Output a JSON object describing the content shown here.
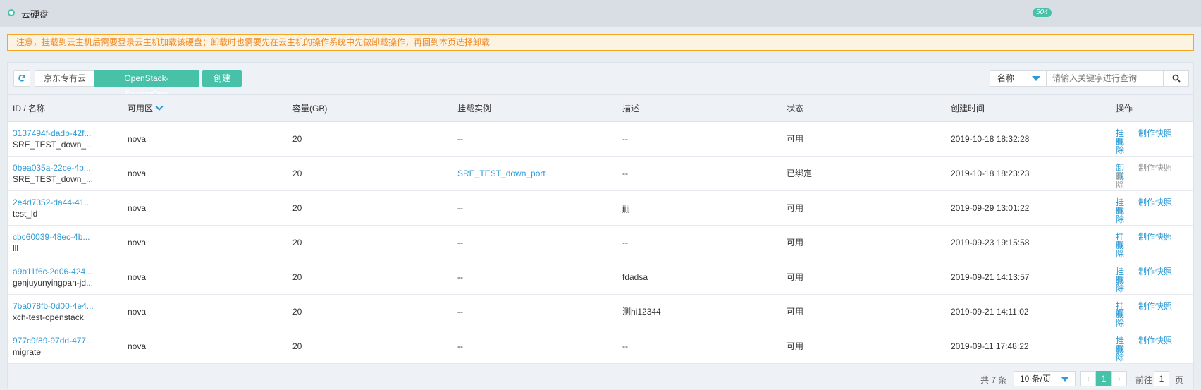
{
  "header": {
    "title": "云硬盘",
    "badge": "504"
  },
  "notice": "注意，挂载到云主机后需要登录云主机加载该硬盘；卸载时也需要先在云主机的操作系统中先做卸载操作，再回到本页选择卸载",
  "toolbar": {
    "refresh_icon": "refresh-icon",
    "region_tabs": [
      "京东专有云",
      "OpenStack-RegionOne"
    ],
    "create_label": "创建",
    "search_field": "名称",
    "search_placeholder": "请输入关键字进行查询"
  },
  "table": {
    "headers": {
      "id_name": "ID / 名称",
      "zone": "可用区",
      "capacity": "容量(GB)",
      "instance": "挂载实例",
      "desc": "描述",
      "status": "状态",
      "created": "创建时间",
      "ops": "操作"
    },
    "rows": [
      {
        "id": "3137494f-dadb-42f...",
        "name": "SRE_TEST_down_...",
        "zone": "nova",
        "capacity": "20",
        "instance": "--",
        "desc": "--",
        "status": "可用",
        "created": "2019-10-18 18:32:28",
        "op1": "挂载",
        "op2": "删除",
        "op3": "制作快照"
      },
      {
        "id": "0bea035a-22ce-4b...",
        "name": "SRE_TEST_down_...",
        "zone": "nova",
        "capacity": "20",
        "instance": "SRE_TEST_down_port",
        "desc": "--",
        "status": "已绑定",
        "created": "2019-10-18 18:23:23",
        "op1": "卸载",
        "op2": "删除",
        "op3": "制作快照"
      },
      {
        "id": "2e4d7352-da44-41...",
        "name": "test_ld",
        "zone": "nova",
        "capacity": "20",
        "instance": "--",
        "desc": "jjjj",
        "status": "可用",
        "created": "2019-09-29 13:01:22",
        "op1": "挂载",
        "op2": "删除",
        "op3": "制作快照"
      },
      {
        "id": "cbc60039-48ec-4b...",
        "name": "lll",
        "zone": "nova",
        "capacity": "20",
        "instance": "--",
        "desc": "--",
        "status": "可用",
        "created": "2019-09-23 19:15:58",
        "op1": "挂载",
        "op2": "删除",
        "op3": "制作快照"
      },
      {
        "id": "a9b11f6c-2d06-424...",
        "name": "genjuyunyingpan-jd...",
        "zone": "nova",
        "capacity": "20",
        "instance": "--",
        "desc": "fdadsa",
        "status": "可用",
        "created": "2019-09-21 14:13:57",
        "op1": "挂载",
        "op2": "删除",
        "op3": "制作快照"
      },
      {
        "id": "7ba078fb-0d00-4e4...",
        "name": "xch-test-openstack",
        "zone": "nova",
        "capacity": "20",
        "instance": "--",
        "desc": "测hi12344",
        "status": "可用",
        "created": "2019-09-21 14:11:02",
        "op1": "挂载",
        "op2": "删除",
        "op3": "制作快照"
      },
      {
        "id": "977c9f89-97dd-477...",
        "name": "migrate",
        "zone": "nova",
        "capacity": "20",
        "instance": "--",
        "desc": "--",
        "status": "可用",
        "created": "2019-09-11 17:48:22",
        "op1": "挂载",
        "op2": "删除",
        "op3": "制作快照"
      }
    ]
  },
  "pagination": {
    "total": "共 7 条",
    "page_size": "10 条/页",
    "current": "1",
    "goto_label": "前往",
    "goto_value": "1",
    "page_unit": "页"
  }
}
